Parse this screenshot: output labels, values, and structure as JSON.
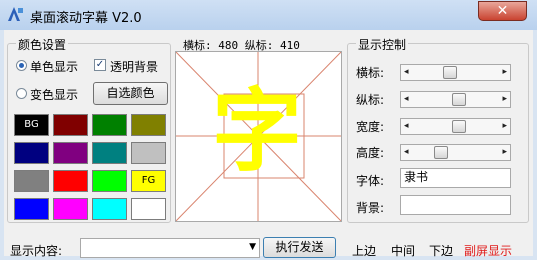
{
  "window": {
    "title": "桌面滚动字幕 V2.0",
    "close_label": "✕"
  },
  "colors": {
    "accent": "#2a63b5",
    "preview_char": "#ffff00",
    "guide_lines": "#d9846e",
    "red_link": "#e01c1c"
  },
  "color_settings": {
    "legend": "颜色设置",
    "single_color_label": "单色显示",
    "single_color_selected": true,
    "transparent_bg_label": "透明背景",
    "transparent_bg_checked": true,
    "variable_color_label": "变色显示",
    "variable_color_selected": false,
    "custom_color_button": "自选颜色",
    "swatches": [
      {
        "color": "#000000",
        "text": "BG",
        "text_color": "#ffffff"
      },
      {
        "color": "#800000",
        "text": ""
      },
      {
        "color": "#008000",
        "text": ""
      },
      {
        "color": "#808000",
        "text": ""
      },
      {
        "color": "#000080",
        "text": ""
      },
      {
        "color": "#800080",
        "text": ""
      },
      {
        "color": "#008080",
        "text": ""
      },
      {
        "color": "#c0c0c0",
        "text": ""
      },
      {
        "color": "#808080",
        "text": ""
      },
      {
        "color": "#ff0000",
        "text": ""
      },
      {
        "color": "#00ff00",
        "text": ""
      },
      {
        "color": "#ffff00",
        "text": "FG",
        "text_color": "#000000"
      },
      {
        "color": "#0000ff",
        "text": ""
      },
      {
        "color": "#ff00ff",
        "text": ""
      },
      {
        "color": "#00ffff",
        "text": ""
      },
      {
        "color": "#ffffff",
        "text": ""
      }
    ]
  },
  "preview": {
    "coords": "横标: 480 纵标: 410",
    "char": "字"
  },
  "display_control": {
    "legend": "显示控制",
    "horizontal_label": "横标:",
    "horizontal_value": 0.42,
    "vertical_label": "纵标:",
    "vertical_value": 0.55,
    "width_label": "宽度:",
    "width_value": 0.55,
    "height_label": "高度:",
    "height_value": 0.3,
    "font_label": "字体:",
    "font_value": "隶书",
    "background_label": "背景:",
    "background_value": "",
    "left_arrow": "◂",
    "right_arrow": "▸"
  },
  "bottom": {
    "content_label": "显示内容:",
    "content_value": "",
    "dropdown_arrow": "▼",
    "execute_button": "执行发送",
    "top_link": "上边",
    "middle_link": "中间",
    "bottom_link": "下边",
    "second_screen_link": "副屏显示"
  }
}
